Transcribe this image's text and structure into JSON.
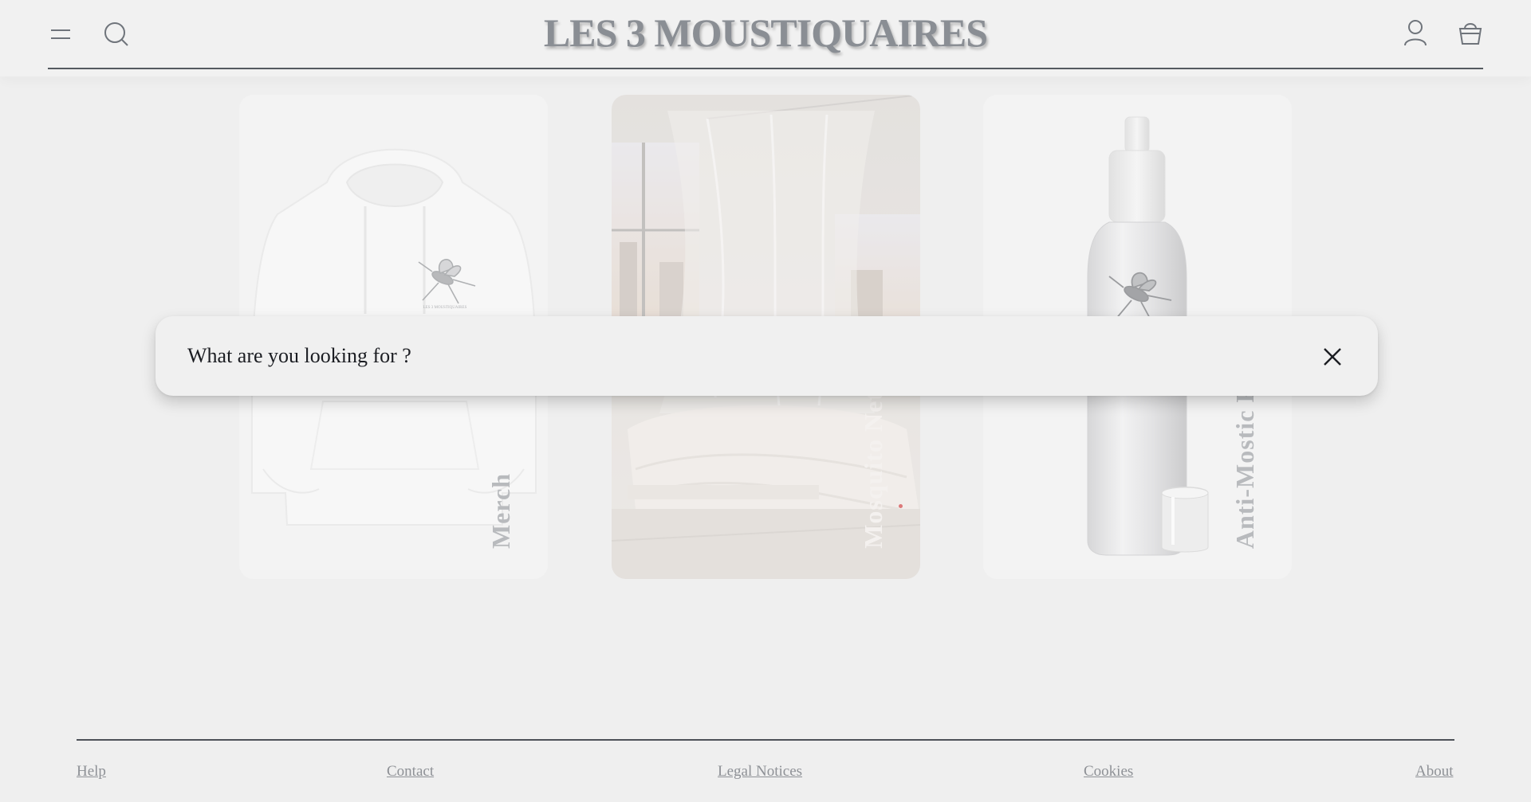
{
  "header": {
    "logo": "LES 3 MOUSTIQUAIRES",
    "icons": {
      "menu": "menu-icon",
      "search": "search-icon",
      "account": "user-icon",
      "cart": "basket-icon"
    }
  },
  "categories": [
    {
      "label": "Merch"
    },
    {
      "label": "Mosquito Net"
    },
    {
      "label": "Anti-Mostic P"
    }
  ],
  "search": {
    "placeholder": "What are you looking for ?"
  },
  "footer": {
    "links": [
      "Help",
      "Contact",
      "Legal Notices",
      "Cookies",
      "About"
    ]
  },
  "colors": {
    "background": "#efefef",
    "header_line": "#555a60",
    "text_dark": "#1b1d22",
    "muted": "#8e9196"
  }
}
